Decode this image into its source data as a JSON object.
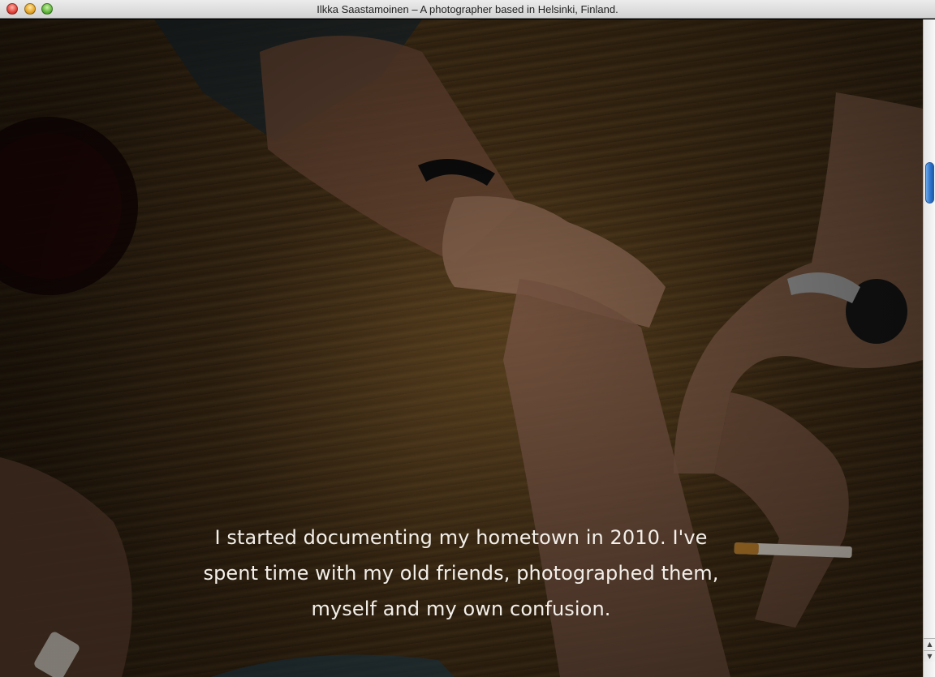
{
  "window": {
    "title": "Ilkka Saastamoinen – A photographer based in Helsinki, Finland."
  },
  "hero": {
    "caption": "I started documenting my hometown in 2010. I've spent time with my old friends, photographed them, myself and my own confusion."
  },
  "scrollbar": {
    "up_icon": "▲",
    "down_icon": "▼",
    "position_fraction": 0.2
  }
}
